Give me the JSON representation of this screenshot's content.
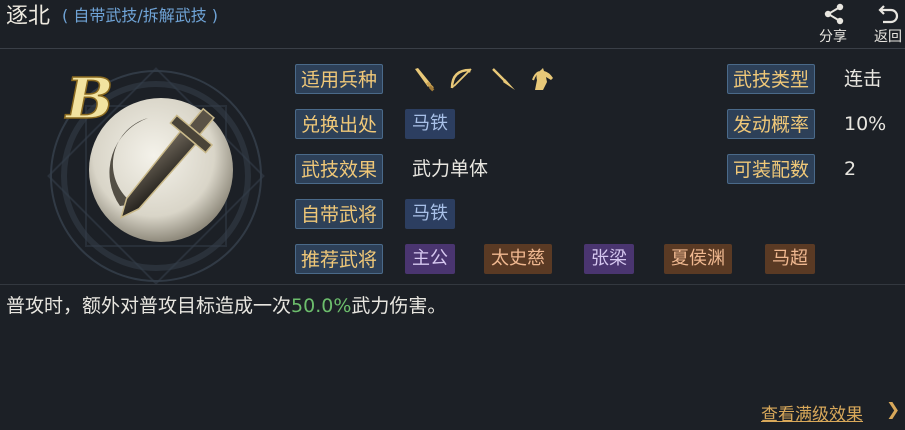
{
  "header": {
    "title": "逐北",
    "subtitle": "( 自带武技/拆解武技 )",
    "share_label": "分享",
    "back_label": "返回"
  },
  "skill": {
    "grade": "B",
    "fields": {
      "unit_type_label": "适用兵种",
      "unit_types": [
        "sword-icon",
        "bow-icon",
        "spear-icon",
        "horse-icon"
      ],
      "source_label": "兑换出处",
      "source_value": "马铁",
      "effect_label": "武技效果",
      "effect_value": "武力单体",
      "own_general_label": "自带武将",
      "own_general_value": "马铁",
      "recommend_label": "推荐武将",
      "recommend": [
        {
          "name": "主公",
          "color": "purple"
        },
        {
          "name": "太史慈",
          "color": "orange"
        },
        {
          "name": "张梁",
          "color": "purple"
        },
        {
          "name": "夏侯渊",
          "color": "orange"
        },
        {
          "name": "马超",
          "color": "orange"
        }
      ],
      "type_label": "武技类型",
      "type_value": "连击",
      "rate_label": "发动概率",
      "rate_value": "10%",
      "equip_label": "可装配数",
      "equip_value": "2"
    }
  },
  "description": {
    "prefix": "普攻时，额外对普攻目标造成一次",
    "highlight": "50.0%",
    "suffix": "武力伤害。"
  },
  "footer": {
    "max_level_link": "查看满级效果",
    "arrow": "❯"
  },
  "colors": {
    "tag_text": "#f0c878",
    "highlight": "#6cbd6c",
    "subtitle": "#6fa3d6",
    "link": "#d8a85a"
  }
}
